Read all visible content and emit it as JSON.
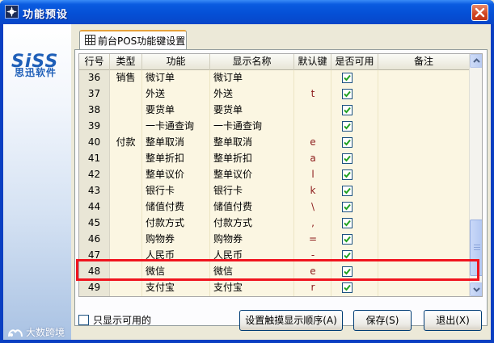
{
  "window": {
    "title": "功能预设",
    "title_icon": "app-icon",
    "close_icon": "close-icon"
  },
  "brand": {
    "logo": "SiSS",
    "logo_sub": "思迅软件"
  },
  "watermark": {
    "text": "大数跨境"
  },
  "tab": {
    "label": "前台POS功能键设置",
    "icon": "grid-icon"
  },
  "table": {
    "columns": [
      "行号",
      "类型",
      "功能",
      "显示名称",
      "默认键",
      "是否可用",
      "备注"
    ],
    "rows": [
      {
        "no": "36",
        "type": "销售",
        "func": "微订单",
        "disp": "微订单",
        "key": "",
        "enabled": true,
        "note": ""
      },
      {
        "no": "37",
        "type": "",
        "func": "外送",
        "disp": "外送",
        "key": "t",
        "enabled": true,
        "note": ""
      },
      {
        "no": "38",
        "type": "",
        "func": "要货单",
        "disp": "要货单",
        "key": "",
        "enabled": true,
        "note": ""
      },
      {
        "no": "39",
        "type": "",
        "func": "一卡通查询",
        "disp": "一卡通查询",
        "key": "",
        "enabled": true,
        "note": ""
      },
      {
        "no": "40",
        "type": "付款",
        "func": "整单取消",
        "disp": "整单取消",
        "key": "e",
        "enabled": true,
        "note": ""
      },
      {
        "no": "41",
        "type": "",
        "func": "整单折扣",
        "disp": "整单折扣",
        "key": "a",
        "enabled": true,
        "note": ""
      },
      {
        "no": "42",
        "type": "",
        "func": "整单议价",
        "disp": "整单议价",
        "key": "l",
        "enabled": true,
        "note": ""
      },
      {
        "no": "43",
        "type": "",
        "func": "银行卡",
        "disp": "银行卡",
        "key": "k",
        "enabled": true,
        "note": ""
      },
      {
        "no": "44",
        "type": "",
        "func": "储值付费",
        "disp": "储值付费",
        "key": "\\",
        "enabled": true,
        "note": ""
      },
      {
        "no": "45",
        "type": "",
        "func": "付款方式",
        "disp": "付款方式",
        "key": ",",
        "enabled": true,
        "note": ""
      },
      {
        "no": "46",
        "type": "",
        "func": "购物券",
        "disp": "购物券",
        "key": "=",
        "enabled": true,
        "note": ""
      },
      {
        "no": "47",
        "type": "",
        "func": "人民币",
        "disp": "人民币",
        "key": "-",
        "enabled": true,
        "note": ""
      },
      {
        "no": "48",
        "type": "",
        "func": "微信",
        "disp": "微信",
        "key": "e",
        "enabled": true,
        "note": ""
      },
      {
        "no": "49",
        "type": "",
        "func": "支付宝",
        "disp": "支付宝",
        "key": "r",
        "enabled": true,
        "note": ""
      }
    ],
    "highlighted_row": "48",
    "highlight_color": "#f0141e"
  },
  "footer": {
    "only_available_label": "只显示可用的",
    "only_available_checked": false,
    "touch_order_button": "设置触摸显示顺序(A)",
    "save_button": "保存(S)",
    "exit_button": "退出(X)"
  },
  "colors": {
    "titlebar": "#0a5be0",
    "grid_bg": "#fbf6e2",
    "key_text": "#8b1a1a"
  }
}
